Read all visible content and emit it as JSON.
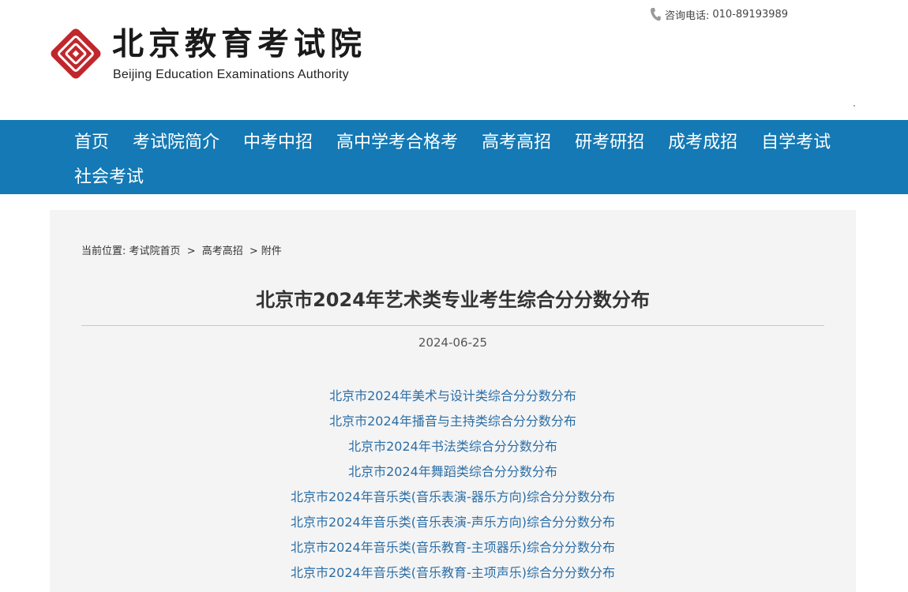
{
  "header": {
    "logo_cn": "北京教育考试院",
    "logo_en": "Beijing Education Examinations Authority",
    "contact_label": "咨询电话:",
    "contact_phone": "010-89193989"
  },
  "nav": {
    "items": [
      {
        "label": "首页"
      },
      {
        "label": "考试院简介"
      },
      {
        "label": "中考中招"
      },
      {
        "label": "高中学考合格考"
      },
      {
        "label": "高考高招"
      },
      {
        "label": "研考研招"
      },
      {
        "label": "成考成招"
      },
      {
        "label": "自学考试"
      },
      {
        "label": "社会考试"
      }
    ]
  },
  "breadcrumb": {
    "prefix": "当前位置:",
    "items": [
      "考试院首页",
      "高考高招",
      "附件"
    ],
    "sep": ">"
  },
  "article": {
    "title": "北京市2024年艺术类专业考生综合分分数分布",
    "date": "2024-06-25",
    "attachments": [
      "北京市2024年美术与设计类综合分分数分布",
      "北京市2024年播音与主持类综合分分数分布",
      "北京市2024年书法类综合分分数分布",
      "北京市2024年舞蹈类综合分分数分布",
      "北京市2024年音乐类(音乐表演-器乐方向)综合分分数分布",
      "北京市2024年音乐类(音乐表演-声乐方向)综合分分数分布",
      "北京市2024年音乐类(音乐教育-主项器乐)综合分分数分布",
      "北京市2024年音乐类(音乐教育-主项声乐)综合分分数分布"
    ]
  },
  "colors": {
    "nav_bg": "#1479b4",
    "logo_red": "#c0272d",
    "link": "#2b6ea6",
    "panel_bg": "#f4f4f4"
  }
}
